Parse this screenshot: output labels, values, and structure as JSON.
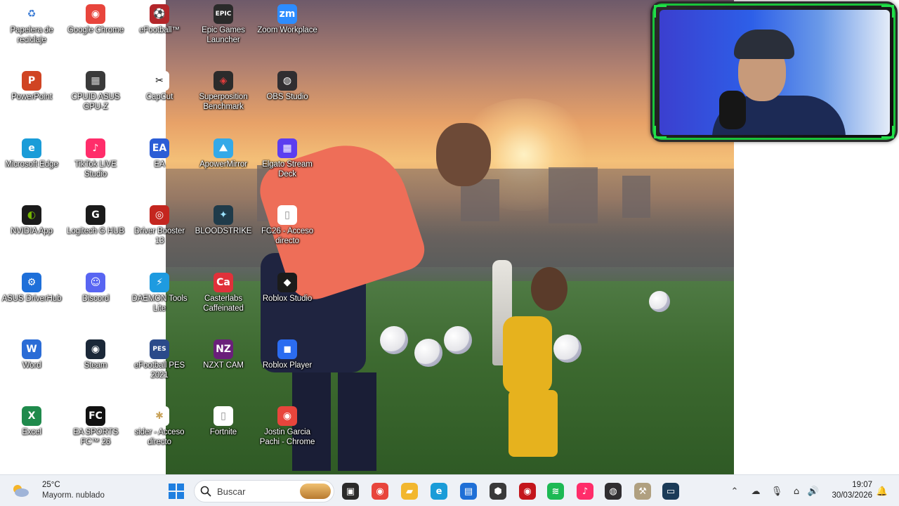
{
  "desktop": {
    "icons": [
      {
        "label": "Papelera de reciclaje",
        "icon": "recycle-bin-icon",
        "color": "#ffffff",
        "glyph": "♻",
        "glyph_color": "#3a7bd5"
      },
      {
        "label": "Google Chrome",
        "icon": "chrome-icon",
        "color": "#e8453c",
        "glyph": "◉",
        "glyph_color": "#ffffff"
      },
      {
        "label": "eFootball™",
        "icon": "efootball-icon",
        "color": "#b3262a",
        "glyph": "⚽",
        "glyph_color": "#ffd34a"
      },
      {
        "label": "Epic Games Launcher",
        "icon": "epic-games-icon",
        "color": "#2a2a2a",
        "glyph": "EPIC",
        "glyph_color": "#ffffff"
      },
      {
        "label": "Zoom Workplace",
        "icon": "zoom-icon",
        "color": "#2d8cff",
        "glyph": "zm",
        "glyph_color": "#ffffff"
      },
      {
        "label": "PowerPoint",
        "icon": "powerpoint-icon",
        "color": "#d04423",
        "glyph": "P",
        "glyph_color": "#ffffff"
      },
      {
        "label": "CPUID ASUS GPU-Z",
        "icon": "gpuz-icon",
        "color": "#3a3a3a",
        "glyph": "▦",
        "glyph_color": "#d0d0d0"
      },
      {
        "label": "CapCut",
        "icon": "capcut-icon",
        "color": "#ffffff",
        "glyph": "✂",
        "glyph_color": "#000000"
      },
      {
        "label": "Superposition Benchmark",
        "icon": "superposition-icon",
        "color": "#2b2b2b",
        "glyph": "◈",
        "glyph_color": "#e23c3c"
      },
      {
        "label": "OBS Studio",
        "icon": "obs-icon",
        "color": "#302e31",
        "glyph": "◍",
        "glyph_color": "#ffffff"
      },
      {
        "label": "Microsoft Edge",
        "icon": "edge-icon",
        "color": "#1a9cd8",
        "glyph": "e",
        "glyph_color": "#ffffff"
      },
      {
        "label": "TikTok LIVE Studio",
        "icon": "tiktok-live-icon",
        "color": "#ff2d6a",
        "glyph": "♪",
        "glyph_color": "#ffffff"
      },
      {
        "label": "EA",
        "icon": "ea-icon",
        "color": "#2b5dd6",
        "glyph": "EA",
        "glyph_color": "#ffffff"
      },
      {
        "label": "ApowerMirror",
        "icon": "apowermirror-icon",
        "color": "#34a9e8",
        "glyph": "⛰",
        "glyph_color": "#ffffff"
      },
      {
        "label": "Elgato Stream Deck",
        "icon": "stream-deck-icon",
        "color": "#5b3ef0",
        "glyph": "▦",
        "glyph_color": "#ffffff"
      },
      {
        "label": "NVIDIA App",
        "icon": "nvidia-icon",
        "color": "#1b1b1b",
        "glyph": "◐",
        "glyph_color": "#76b900"
      },
      {
        "label": "Logitech G HUB",
        "icon": "logitech-ghub-icon",
        "color": "#1b1b1b",
        "glyph": "G",
        "glyph_color": "#ffffff"
      },
      {
        "label": "Driver Booster 13",
        "icon": "driver-booster-icon",
        "color": "#c4261f",
        "glyph": "◎",
        "glyph_color": "#ffffff"
      },
      {
        "label": "BLOODSTRIKE",
        "icon": "bloodstrike-icon",
        "color": "#1f3b4a",
        "glyph": "✦",
        "glyph_color": "#9be3ff"
      },
      {
        "label": "FC26 - Acceso directo",
        "icon": "shortcut-file-icon",
        "color": "#ffffff",
        "glyph": "▯",
        "glyph_color": "#8a8a8a"
      },
      {
        "label": "ASUS DriverHub",
        "icon": "asus-driverhub-icon",
        "color": "#1e6fd9",
        "glyph": "⚙",
        "glyph_color": "#ffffff"
      },
      {
        "label": "Discord",
        "icon": "discord-icon",
        "color": "#5865f2",
        "glyph": "☺",
        "glyph_color": "#ffffff"
      },
      {
        "label": "DAEMON Tools Lite",
        "icon": "daemon-tools-icon",
        "color": "#1e9be0",
        "glyph": "⚡",
        "glyph_color": "#ffffff"
      },
      {
        "label": "Casterlabs Caffeinated",
        "icon": "casterlabs-icon",
        "color": "#e0313a",
        "glyph": "Ca",
        "glyph_color": "#ffffff"
      },
      {
        "label": "Roblox Studio",
        "icon": "roblox-studio-icon",
        "color": "#1b1b1b",
        "glyph": "◆",
        "glyph_color": "#ffffff"
      },
      {
        "label": "Word",
        "icon": "word-icon",
        "color": "#2b6cd6",
        "glyph": "W",
        "glyph_color": "#ffffff"
      },
      {
        "label": "Steam",
        "icon": "steam-icon",
        "color": "#1b2838",
        "glyph": "◉",
        "glyph_color": "#ffffff"
      },
      {
        "label": "eFootball PES 2021",
        "icon": "pes-2021-icon",
        "color": "#2b4a8a",
        "glyph": "PES",
        "glyph_color": "#ffffff"
      },
      {
        "label": "NZXT CAM",
        "icon": "nzxt-cam-icon",
        "color": "#6a1f7a",
        "glyph": "NZ",
        "glyph_color": "#ffffff"
      },
      {
        "label": "Roblox Player",
        "icon": "roblox-player-icon",
        "color": "#2b6cf0",
        "glyph": "◼",
        "glyph_color": "#ffffff"
      },
      {
        "label": "Excel",
        "icon": "excel-icon",
        "color": "#1f8a4c",
        "glyph": "X",
        "glyph_color": "#ffffff"
      },
      {
        "label": "EA SPORTS FC™ 26",
        "icon": "ea-sports-fc-icon",
        "color": "#111111",
        "glyph": "FC",
        "glyph_color": "#ffffff"
      },
      {
        "label": "sider - Acceso directo",
        "icon": "sider-icon",
        "color": "#ffffff",
        "glyph": "✱",
        "glyph_color": "#c9a35a"
      },
      {
        "label": "Fortnite",
        "icon": "fortnite-file-icon",
        "color": "#ffffff",
        "glyph": "▯",
        "glyph_color": "#8a8a8a"
      },
      {
        "label": "Jostin Garcia Pachi - Chrome",
        "icon": "chrome-profile-icon",
        "color": "#e8453c",
        "glyph": "◉",
        "glyph_color": "#ffffff"
      }
    ]
  },
  "taskbar": {
    "weather": {
      "temp": "25°C",
      "desc": "Mayorm. nublado",
      "icon": "partly-cloudy-icon"
    },
    "search": {
      "placeholder": "Buscar"
    },
    "apps": [
      {
        "icon": "task-view-icon",
        "color": "#2a2a2a",
        "glyph": "▣"
      },
      {
        "icon": "chrome-icon",
        "color": "#e8453c",
        "glyph": "◉"
      },
      {
        "icon": "file-explorer-icon",
        "color": "#f2b72e",
        "glyph": "▰"
      },
      {
        "icon": "edge-icon",
        "color": "#1a9cd8",
        "glyph": "e"
      },
      {
        "icon": "microsoft-store-icon",
        "color": "#1f6fd6",
        "glyph": "▤"
      },
      {
        "icon": "app-cube-icon",
        "color": "#3a3a3a",
        "glyph": "⬢"
      },
      {
        "icon": "red-circle-app-icon",
        "color": "#c4161c",
        "glyph": "◉"
      },
      {
        "icon": "spotify-icon",
        "color": "#1db954",
        "glyph": "≋"
      },
      {
        "icon": "tiktok-icon",
        "color": "#ff2d6a",
        "glyph": "♪"
      },
      {
        "icon": "obs-icon",
        "color": "#302e31",
        "glyph": "◍"
      },
      {
        "icon": "tools-icon",
        "color": "#b0a080",
        "glyph": "⚒"
      },
      {
        "icon": "monitor-app-icon",
        "color": "#1b3b58",
        "glyph": "▭"
      }
    ],
    "tray": [
      {
        "icon": "chevron-up-icon",
        "glyph": "⌃"
      },
      {
        "icon": "onedrive-icon",
        "glyph": "☁"
      },
      {
        "icon": "microphone-icon",
        "glyph": "🎙"
      },
      {
        "icon": "network-icon",
        "glyph": "⌂"
      },
      {
        "icon": "volume-icon",
        "glyph": "🔊"
      }
    ],
    "clock": {
      "time": "19:07",
      "date": "30/03/2026"
    },
    "notification": {
      "icon": "notification-bell-icon",
      "glyph": "🔔"
    }
  },
  "colors": {
    "webcam_border": "#19c43a",
    "taskbar_bg": "#eef1f6"
  }
}
